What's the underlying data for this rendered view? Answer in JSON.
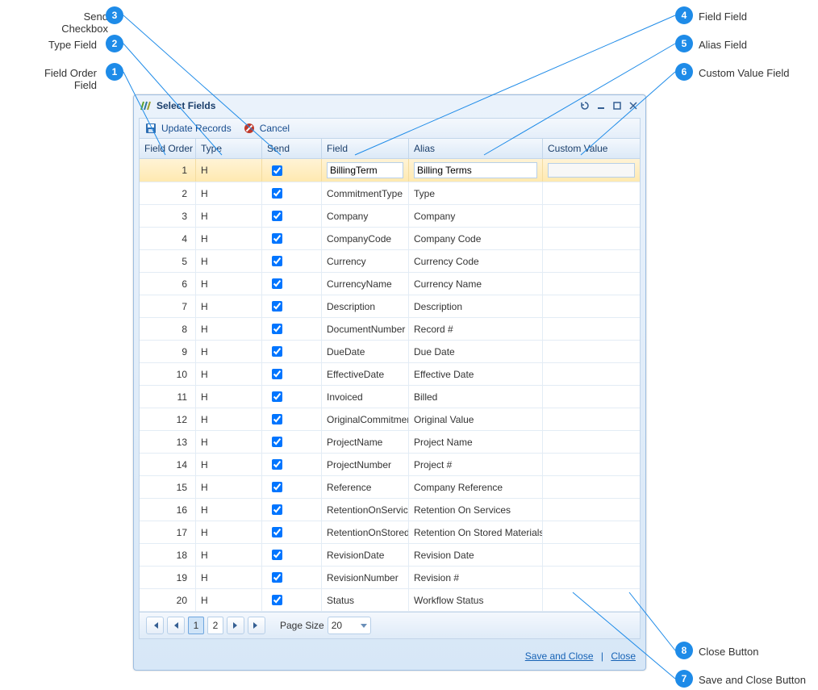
{
  "callouts": {
    "left": [
      {
        "num": "3",
        "text": "Send Checkbox"
      },
      {
        "num": "2",
        "text": "Type Field"
      },
      {
        "num": "1",
        "text": "Field Order Field"
      }
    ],
    "right": [
      {
        "num": "4",
        "text": "Field Field"
      },
      {
        "num": "5",
        "text": "Alias Field"
      },
      {
        "num": "6",
        "text": "Custom Value Field"
      },
      {
        "num": "8",
        "text": "Close Button"
      },
      {
        "num": "7",
        "text": "Save and Close Button"
      }
    ]
  },
  "window_title": "Select Fields",
  "toolbar": {
    "update": "Update Records",
    "cancel": "Cancel"
  },
  "columns": {
    "order": "Field Order",
    "type": "Type",
    "send": "Send",
    "field": "Field",
    "alias": "Alias",
    "custom": "Custom Value"
  },
  "rows": [
    {
      "order": "1",
      "type": "H",
      "send": true,
      "field": "BillingTerm",
      "alias": "Billing Terms",
      "selected": true
    },
    {
      "order": "2",
      "type": "H",
      "send": true,
      "field": "CommitmentType",
      "alias": "Type"
    },
    {
      "order": "3",
      "type": "H",
      "send": true,
      "field": "Company",
      "alias": "Company"
    },
    {
      "order": "4",
      "type": "H",
      "send": true,
      "field": "CompanyCode",
      "alias": "Company Code"
    },
    {
      "order": "5",
      "type": "H",
      "send": true,
      "field": "Currency",
      "alias": "Currency Code"
    },
    {
      "order": "6",
      "type": "H",
      "send": true,
      "field": "CurrencyName",
      "alias": "Currency Name"
    },
    {
      "order": "7",
      "type": "H",
      "send": true,
      "field": "Description",
      "alias": "Description"
    },
    {
      "order": "8",
      "type": "H",
      "send": true,
      "field": "DocumentNumber",
      "alias": "Record #"
    },
    {
      "order": "9",
      "type": "H",
      "send": true,
      "field": "DueDate",
      "alias": "Due Date"
    },
    {
      "order": "10",
      "type": "H",
      "send": true,
      "field": "EffectiveDate",
      "alias": "Effective Date"
    },
    {
      "order": "11",
      "type": "H",
      "send": true,
      "field": "Invoiced",
      "alias": "Billed"
    },
    {
      "order": "12",
      "type": "H",
      "send": true,
      "field": "OriginalCommitmentValue",
      "alias": "Original Value"
    },
    {
      "order": "13",
      "type": "H",
      "send": true,
      "field": "ProjectName",
      "alias": "Project Name"
    },
    {
      "order": "14",
      "type": "H",
      "send": true,
      "field": "ProjectNumber",
      "alias": "Project #"
    },
    {
      "order": "15",
      "type": "H",
      "send": true,
      "field": "Reference",
      "alias": "Company Reference"
    },
    {
      "order": "16",
      "type": "H",
      "send": true,
      "field": "RetentionOnServices",
      "alias": "Retention On Services"
    },
    {
      "order": "17",
      "type": "H",
      "send": true,
      "field": "RetentionOnStoredMaterials",
      "alias": "Retention On Stored Materials"
    },
    {
      "order": "18",
      "type": "H",
      "send": true,
      "field": "RevisionDate",
      "alias": "Revision Date"
    },
    {
      "order": "19",
      "type": "H",
      "send": true,
      "field": "RevisionNumber",
      "alias": "Revision #"
    },
    {
      "order": "20",
      "type": "H",
      "send": true,
      "field": "Status",
      "alias": "Workflow Status"
    }
  ],
  "pager": {
    "page1": "1",
    "page2": "2",
    "size_label": "Page Size",
    "size_value": "20"
  },
  "bottom": {
    "save_close": "Save and Close",
    "close": "Close",
    "sep": "|"
  }
}
